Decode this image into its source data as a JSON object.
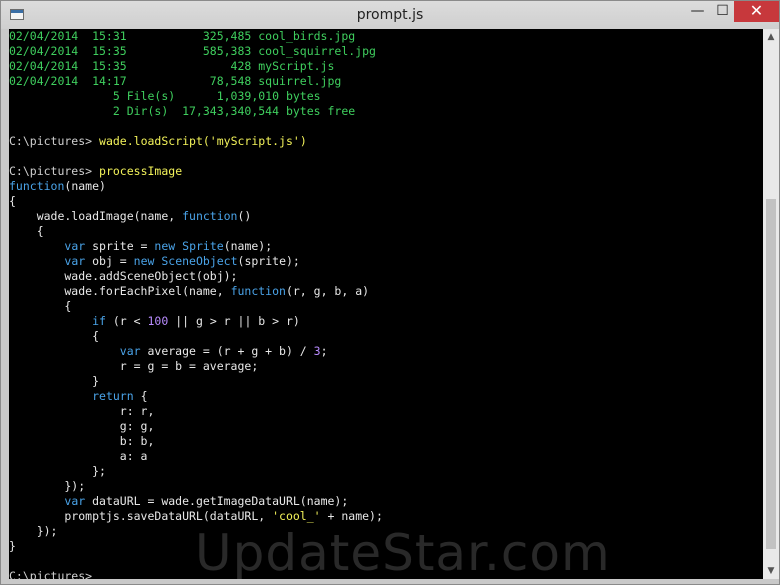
{
  "window": {
    "title": "prompt.js",
    "min_label": "—",
    "max_label": "☐",
    "close_label": "✕"
  },
  "console": {
    "dir_lines": [
      "02/04/2014  15:31           325,485 cool_birds.jpg",
      "02/04/2014  15:35           585,383 cool_squirrel.jpg",
      "02/04/2014  15:35               428 myScript.js",
      "02/04/2014  14:17            78,548 squirrel.jpg",
      "               5 File(s)      1,039,010 bytes",
      "               2 Dir(s)  17,343,340,544 bytes free"
    ],
    "prompt": "C:\\pictures>",
    "command1": "wade.loadScript('myScript.js')",
    "command2": "processImage",
    "code": {
      "l01": "function",
      "l01b": "(name)",
      "l02": "{",
      "l03a": "    wade.loadImage(name, ",
      "l03b": "function",
      "l03c": "()",
      "l04": "    {",
      "l05a": "        ",
      "l05b": "var",
      "l05c": " sprite = ",
      "l05d": "new",
      "l05e": " ",
      "l05f": "Sprite",
      "l05g": "(name);",
      "l06b": "var",
      "l06c": " obj = ",
      "l06d": "new",
      "l06f": "SceneObject",
      "l06g": "(sprite);",
      "l07": "        wade.addSceneObject(obj);",
      "l08a": "        wade.forEachPixel(name, ",
      "l08b": "function",
      "l08c": "(r, g, b, a)",
      "l09": "        {",
      "l10b": "if",
      "l10c": " (r < ",
      "l10d": "100",
      "l10e": " || g > r || b > r)",
      "l11": "            {",
      "l12b": "var",
      "l12c": " average = (r + g + b) / ",
      "l12d": "3",
      "l12e": ";",
      "l13": "                r = g = b = average;",
      "l14": "            }",
      "l15b": "return",
      "l15c": " {",
      "l16": "                r: r,",
      "l17": "                g: g,",
      "l18": "                b: b,",
      "l19": "                a: a",
      "l20": "            };",
      "l21": "        });",
      "l22b": "var",
      "l22c": " dataURL = wade.getImageDataURL(name);",
      "l23a": "        promptjs.saveDataURL(dataURL, ",
      "l23b": "'cool_'",
      "l23c": " + name);",
      "l24": "    });",
      "l25": "}"
    }
  },
  "watermark": "UpdateStar.com",
  "scrollbar": {
    "up": "▲",
    "down": "▼"
  }
}
